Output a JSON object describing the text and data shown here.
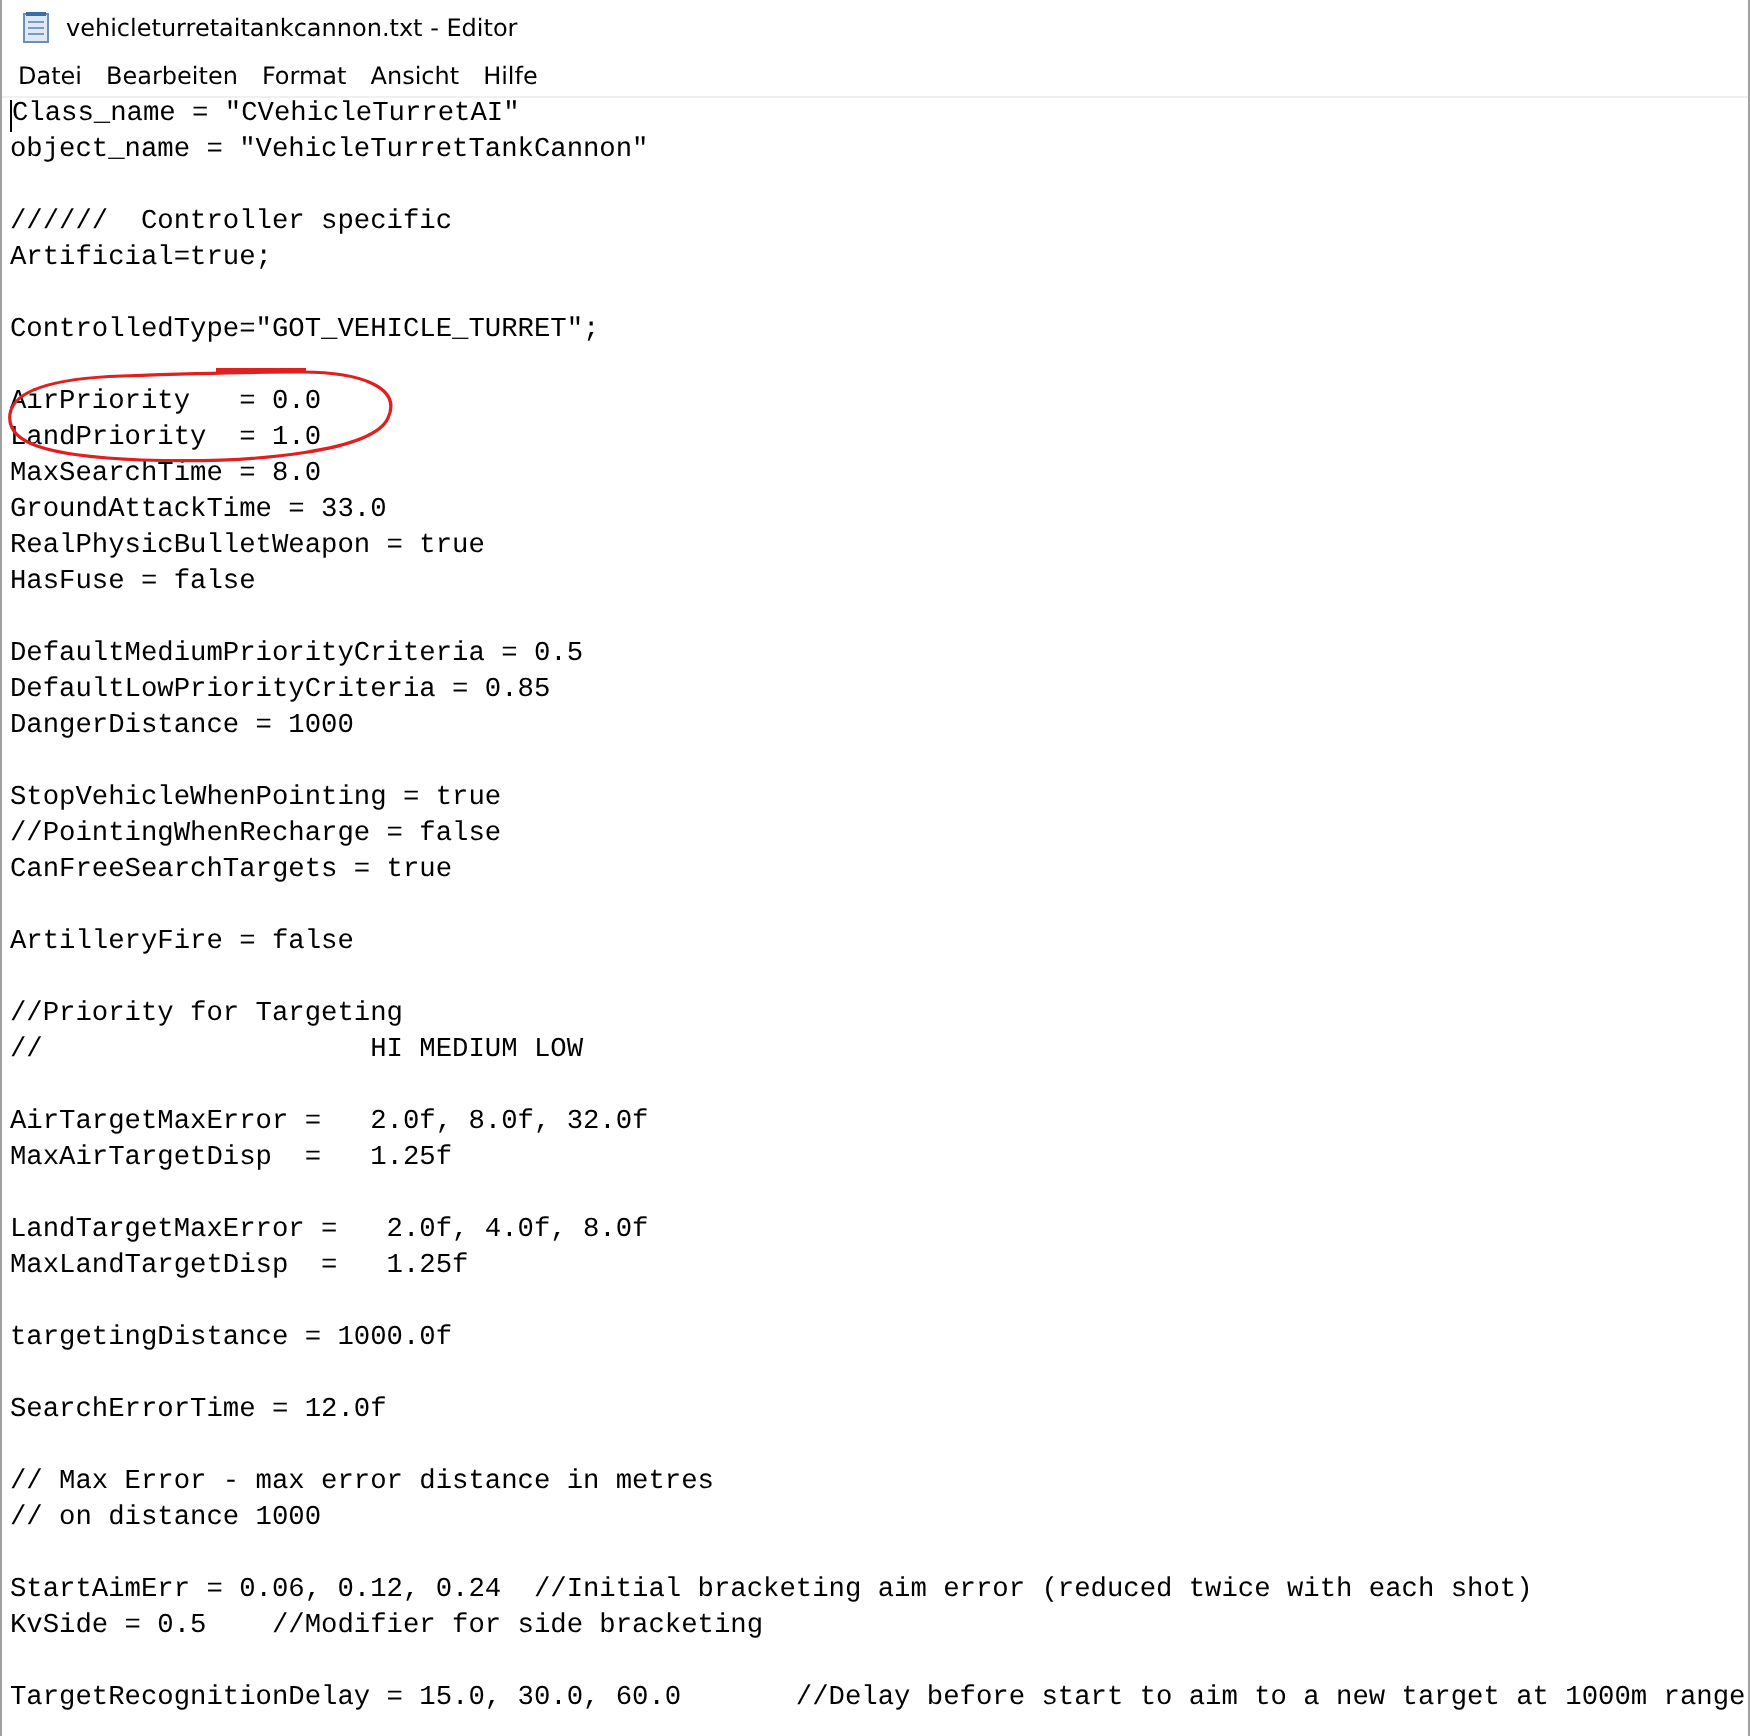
{
  "window": {
    "title": "vehicleturretaitankcannon.txt - Editor"
  },
  "menu": [
    "Datei",
    "Bearbeiten",
    "Format",
    "Ansicht",
    "Hilfe"
  ],
  "blocks": [
    [
      "Class_name = \"CVehicleTurretAI\"",
      "object_name = \"VehicleTurretTankCannon\""
    ],
    [
      "//////  Controller specific",
      "Artificial=true;"
    ],
    [
      "ControlledType=\"GOT_VEHICLE_TURRET\";"
    ],
    [
      "AirPriority   = 0.0",
      "LandPriority  = 1.0",
      "MaxSearchTime = 8.0",
      "GroundAttackTime = 33.0",
      "RealPhysicBulletWeapon = true",
      "HasFuse = false"
    ],
    [
      "DefaultMediumPriorityCriteria = 0.5",
      "DefaultLowPriorityCriteria = 0.85",
      "DangerDistance = 1000"
    ],
    [
      "StopVehicleWhenPointing = true",
      "//PointingWhenRecharge = false",
      "CanFreeSearchTargets = true"
    ],
    [
      "ArtilleryFire = false"
    ],
    [
      "//Priority for Targeting",
      "//                    HI MEDIUM LOW"
    ],
    [
      "AirTargetMaxError =   2.0f, 8.0f, 32.0f",
      "MaxAirTargetDisp  =   1.25f"
    ],
    [
      "LandTargetMaxError =   2.0f, 4.0f, 8.0f",
      "MaxLandTargetDisp  =   1.25f"
    ],
    [
      "targetingDistance = 1000.0f"
    ],
    [
      "SearchErrorTime = 12.0f"
    ],
    [
      "// Max Error - max error distance in metres",
      "// on distance 1000"
    ],
    [
      "StartAimErr = 0.06, 0.12, 0.24  //Initial bracketing aim error (reduced twice with each shot)",
      "KvSide = 0.5    //Modifier for side bracketing"
    ],
    [
      "TargetRecognitionDelay = 15.0, 30.0, 60.0       //Delay before start to aim to a new target at 1000m range"
    ]
  ],
  "markup": {
    "underline": true,
    "circle": true
  }
}
